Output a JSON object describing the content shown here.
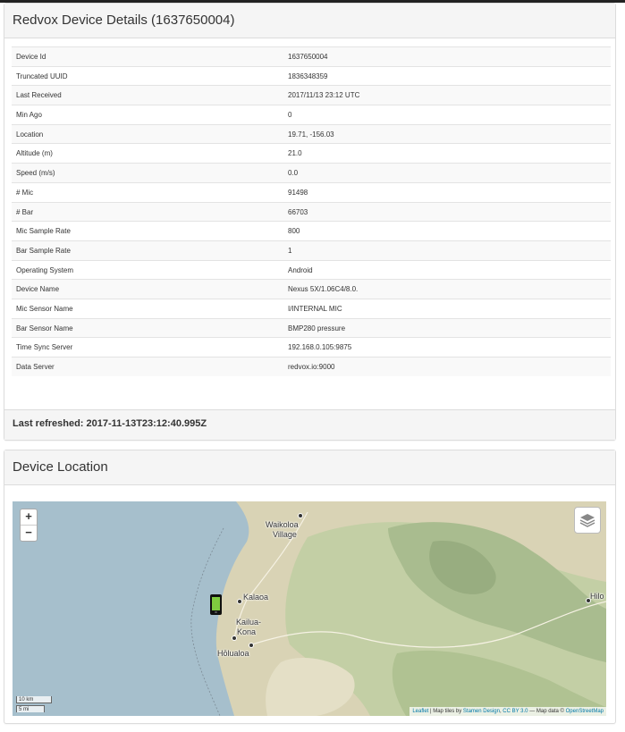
{
  "details_panel": {
    "title": "Redvox Device Details (1637650004)",
    "rows": [
      {
        "key": "Device Id",
        "value": "1637650004"
      },
      {
        "key": "Truncated UUID",
        "value": "1836348359"
      },
      {
        "key": "Last Received",
        "value": "2017/11/13 23:12 UTC"
      },
      {
        "key": "Min Ago",
        "value": "0"
      },
      {
        "key": "Location",
        "value": "19.71, -156.03"
      },
      {
        "key": "Altitude (m)",
        "value": "21.0"
      },
      {
        "key": "Speed (m/s)",
        "value": "0.0"
      },
      {
        "key": "# Mic",
        "value": "91498"
      },
      {
        "key": "# Bar",
        "value": "66703"
      },
      {
        "key": "Mic Sample Rate",
        "value": "800"
      },
      {
        "key": "Bar Sample Rate",
        "value": "1"
      },
      {
        "key": "Operating System",
        "value": "Android"
      },
      {
        "key": "Device Name",
        "value": "Nexus 5X/1.06C4/8.0."
      },
      {
        "key": "Mic Sensor Name",
        "value": "I/INTERNAL MIC"
      },
      {
        "key": "Bar Sensor Name",
        "value": "BMP280 pressure"
      },
      {
        "key": "Time Sync Server",
        "value": "192.168.0.105:9875"
      },
      {
        "key": "Data Server",
        "value": "redvox.io:9000"
      }
    ],
    "footer": "Last refreshed: 2017-11-13T23:12:40.995Z"
  },
  "location_panel": {
    "title": "Device Location",
    "zoom_in": "+",
    "zoom_out": "−",
    "places": {
      "waikoloa_line1": "Waikoloa",
      "waikoloa_line2": "Village",
      "kalaoa": "Kalaoa",
      "kailua_line1": "Kailua-",
      "kailua_line2": "Kona",
      "holualoa": "Hōlualoa",
      "hilo": "Hilo"
    },
    "scale": {
      "km": "10 km",
      "mi": "5 mi"
    },
    "attribution": {
      "leaflet": "Leaflet",
      "text1": " | Map tiles by ",
      "stamen": "Stamen Design",
      "sep": ", ",
      "ccby": "CC BY 3.0",
      "text2": " — Map data © ",
      "osm": "OpenStreetMap"
    },
    "marker_icon": "mobile-phone-icon",
    "layers_icon": "layers-icon"
  },
  "colors": {
    "water": "#a6bfcc",
    "land": "#d9d3b5",
    "vegetation": "#b9c9a0",
    "forest": "#9fb58a",
    "marker_screen": "#7fcb3f",
    "link": "#0078a8"
  }
}
